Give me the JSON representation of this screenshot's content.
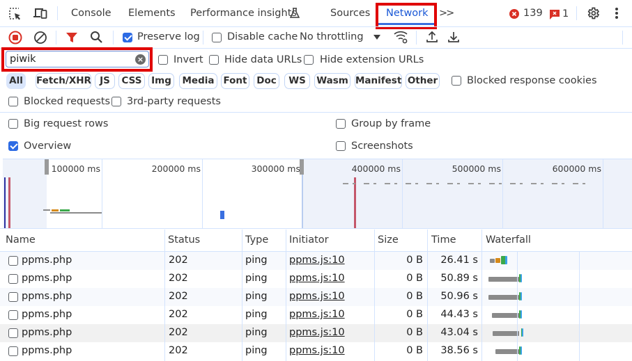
{
  "tabbar": {
    "tabs": [
      {
        "label": "Console",
        "active": false
      },
      {
        "label": "Elements",
        "active": false
      },
      {
        "label": "Performance insights",
        "active": false
      },
      {
        "label": "Sources",
        "active": false
      },
      {
        "label": "Network",
        "active": true
      }
    ],
    "more_tabs_label": ">>",
    "error_count": "139",
    "issue_count": "1"
  },
  "toolbar": {
    "preserve_log": {
      "label": "Preserve log",
      "checked": true
    },
    "disable_cache": {
      "label": "Disable cache",
      "checked": false
    },
    "throttling": "No throttling"
  },
  "filter": {
    "search_value": "piwik",
    "invert": {
      "label": "Invert",
      "checked": false
    },
    "hide_data_urls": {
      "label": "Hide data URLs",
      "checked": false
    },
    "hide_extension_urls": {
      "label": "Hide extension URLs",
      "checked": false
    },
    "types": [
      "All",
      "Fetch/XHR",
      "JS",
      "CSS",
      "Img",
      "Media",
      "Font",
      "Doc",
      "WS",
      "Wasm",
      "Manifest",
      "Other"
    ],
    "selected_type": "All",
    "blocked_response_cookies": {
      "label": "Blocked response cookies",
      "checked": false
    },
    "blocked_requests": {
      "label": "Blocked requests",
      "checked": false
    },
    "third_party_requests": {
      "label": "3rd-party requests",
      "checked": false
    }
  },
  "settings": {
    "big_request_rows": {
      "label": "Big request rows",
      "checked": false
    },
    "group_by_frame": {
      "label": "Group by frame",
      "checked": false
    },
    "overview": {
      "label": "Overview",
      "checked": true
    },
    "screenshots": {
      "label": "Screenshots",
      "checked": false
    }
  },
  "overview": {
    "ticks": [
      "100000 ms",
      "200000 ms",
      "300000 ms",
      "400000 ms",
      "500000 ms",
      "600000 ms"
    ]
  },
  "table": {
    "columns": [
      "Name",
      "Status",
      "Type",
      "Initiator",
      "Size",
      "Time",
      "Waterfall"
    ],
    "rows": [
      {
        "name": "ppms.php",
        "status": "202",
        "type": "ping",
        "initiator": "ppms.js:10",
        "size": "0 B",
        "time": "26.41 s"
      },
      {
        "name": "ppms.php",
        "status": "202",
        "type": "ping",
        "initiator": "ppms.js:10",
        "size": "0 B",
        "time": "50.89 s"
      },
      {
        "name": "ppms.php",
        "status": "202",
        "type": "ping",
        "initiator": "ppms.js:10",
        "size": "0 B",
        "time": "50.96 s"
      },
      {
        "name": "ppms.php",
        "status": "202",
        "type": "ping",
        "initiator": "ppms.js:10",
        "size": "0 B",
        "time": "44.43 s"
      },
      {
        "name": "ppms.php",
        "status": "202",
        "type": "ping",
        "initiator": "ppms.js:10",
        "size": "0 B",
        "time": "43.04 s"
      },
      {
        "name": "ppms.php",
        "status": "202",
        "type": "ping",
        "initiator": "ppms.js:10",
        "size": "0 B",
        "time": "38.56 s"
      }
    ]
  },
  "colors": {
    "accent": "#1a58d6",
    "highlight_box": "#e00000",
    "error": "#d93025",
    "record": "#d93025",
    "waterfall_waiting": "#8a8a8a",
    "waterfall_stalled": "#d68a1a",
    "waterfall_green": "#3aa84a",
    "waterfall_blue": "#3aa2e8"
  }
}
